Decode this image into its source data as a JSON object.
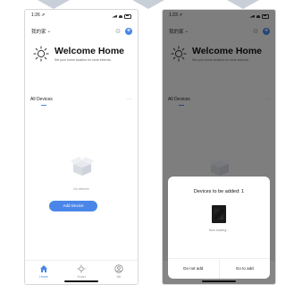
{
  "left": {
    "status": {
      "time": "1:26 ⇗"
    },
    "home": {
      "name": "我的家",
      "dropdown": "⌄"
    },
    "toolbar": {
      "tool_icon": "♲",
      "plus": "+"
    },
    "welcome": {
      "title": "Welcome Home",
      "subtitle": "Set your home location for more informa..."
    },
    "devices": {
      "label": "All Devices",
      "more": "···"
    },
    "empty": {
      "text": "No devices",
      "button": "Add Device"
    },
    "tabs": [
      {
        "label": "Home",
        "icon": "home-icon"
      },
      {
        "label": "Smart",
        "icon": "smart-icon"
      },
      {
        "label": "Me",
        "icon": "me-icon"
      }
    ]
  },
  "right": {
    "status": {
      "time": "1:23 ⇗"
    },
    "home": {
      "name": "我的家",
      "dropdown": "⌄"
    },
    "toolbar": {
      "tool_icon": "♲",
      "plus": "+"
    },
    "welcome": {
      "title": "Welcome Home",
      "subtitle": "Set your home location for more informa..."
    },
    "devices": {
      "label": "All Devices",
      "more": "···"
    },
    "dialog": {
      "title": "Devices to be added: 1",
      "status": "Now loading...",
      "cancel": "Do not add",
      "confirm": "Go to add"
    },
    "tabs": [
      {
        "label": "Home",
        "icon": "home-icon"
      },
      {
        "label": "Smart",
        "icon": "smart-icon"
      },
      {
        "label": "Me",
        "icon": "me-icon"
      }
    ]
  },
  "colors": {
    "accent": "#4a86e8",
    "overlay": "rgba(0,0,0,0.48)"
  }
}
